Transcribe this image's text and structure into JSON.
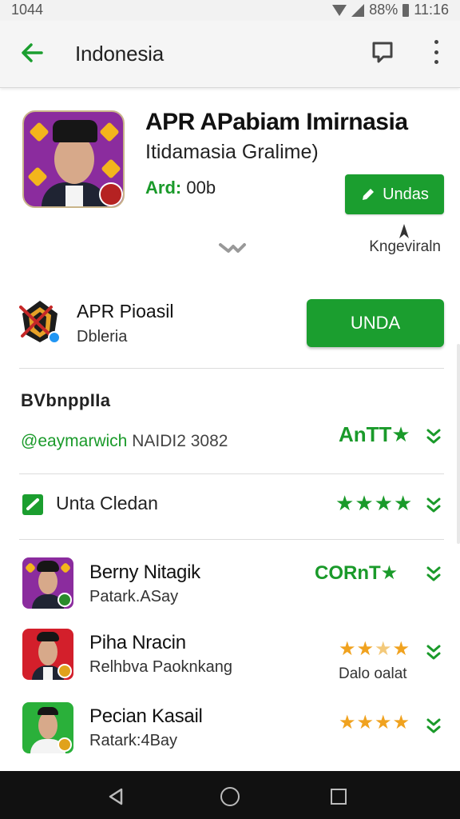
{
  "status_bar": {
    "time_left": "1044",
    "battery": "88%",
    "time_right": "11:16"
  },
  "app_bar": {
    "title": "Indonesia",
    "back_icon": "arrow-left-icon",
    "share_icon": "chat-bubble-icon",
    "more_icon": "more-vert-icon"
  },
  "hero": {
    "title": "APR  APabiam Imirnasia",
    "subtitle": "Itidamasia Gralime)",
    "meta_key": "Ard:",
    "meta_value": "00b",
    "button_label": "Undas",
    "side_link": "Kngeviraln"
  },
  "row2": {
    "title": "APR Pioasil",
    "subtitle": "Dbleria",
    "button_label": "UNDA"
  },
  "section": {
    "title": "BVbnppIIa",
    "developer_handle": "@eaymarwich",
    "developer_date": "NAIDI2 3082",
    "rating_text": "AnTT",
    "rating_color": "#1a9a2a"
  },
  "check_row": {
    "label": "Unta Cledan"
  },
  "list": [
    {
      "title": "Berny Nitagik",
      "subtitle": "Patark.ASay",
      "rating_text": "CORnT"
    },
    {
      "title": "Piha Nracin",
      "subtitle": "Relhbva Paoknkang",
      "caption": "Dalo oalat"
    },
    {
      "title": "Pecian Kasail",
      "subtitle": "Ratark:4Bay"
    }
  ],
  "colors": {
    "accent": "#1b9e2f",
    "star_gold": "#f0a21f",
    "star_green": "#1a9a2a"
  }
}
